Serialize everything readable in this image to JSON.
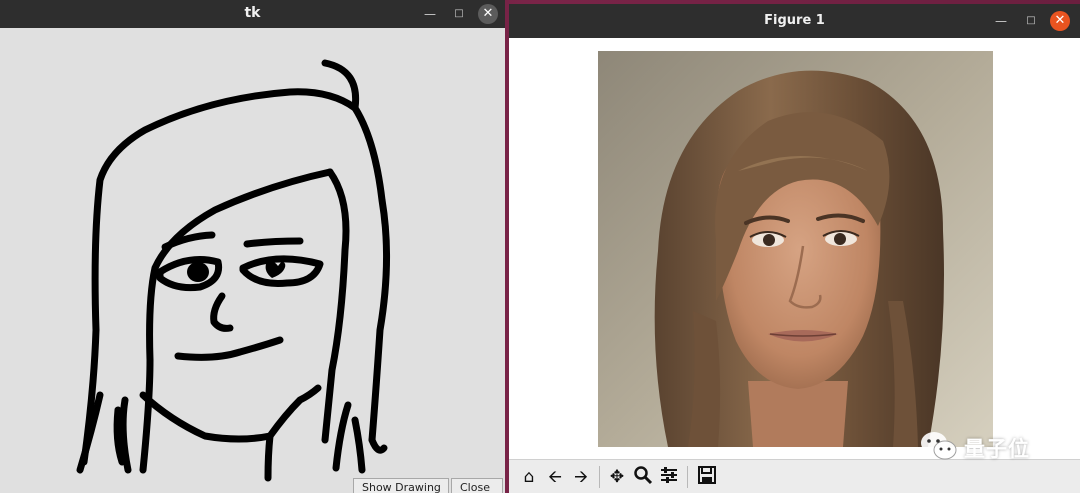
{
  "tk_window": {
    "title": "tk",
    "buttons": [
      "Show Drawing",
      "Close"
    ],
    "controls": [
      "minimize-icon",
      "maximize-icon",
      "close-icon"
    ]
  },
  "figure_window": {
    "title": "Figure 1",
    "controls": [
      "minimize-icon",
      "maximize-icon",
      "close-icon"
    ],
    "toolbar": [
      "home-icon",
      "back-icon",
      "forward-icon",
      "pan-icon",
      "zoom-icon",
      "configure-subplots-icon",
      "save-icon"
    ]
  },
  "watermark": {
    "text": "量子位"
  },
  "colors": {
    "title_bar": "#2e2e2e",
    "close_orange": "#e95420",
    "desktop": "#6b1f3f"
  }
}
